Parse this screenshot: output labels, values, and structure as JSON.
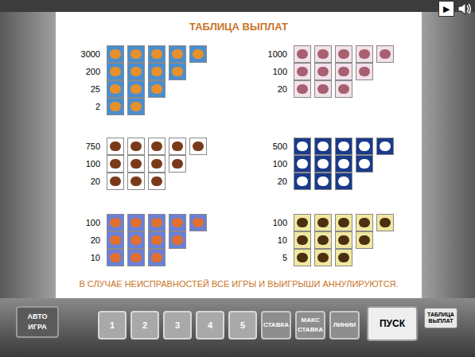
{
  "sound_controls": {
    "play": "▶"
  },
  "title": "ТАБЛИЦА ВЫПЛАТ",
  "groups": [
    {
      "color": "#4a8ed0",
      "accent": "#e8902a",
      "rows": [
        {
          "payout": "3000",
          "count": 5
        },
        {
          "payout": "200",
          "count": 4
        },
        {
          "payout": "25",
          "count": 3
        },
        {
          "payout": "2",
          "count": 2
        }
      ]
    },
    {
      "color": "#f2e2ea",
      "accent": "#a86070",
      "rows": [
        {
          "payout": "1000",
          "count": 5
        },
        {
          "payout": "100",
          "count": 4
        },
        {
          "payout": "20",
          "count": 3
        }
      ]
    },
    {
      "color": "#ffffff",
      "accent": "#7a3a1a",
      "rows": [
        {
          "payout": "750",
          "count": 5
        },
        {
          "payout": "100",
          "count": 4
        },
        {
          "payout": "20",
          "count": 3
        }
      ]
    },
    {
      "color": "#1a3a8a",
      "accent": "#ffffff",
      "rows": [
        {
          "payout": "500",
          "count": 5
        },
        {
          "payout": "100",
          "count": 4
        },
        {
          "payout": "20",
          "count": 3
        }
      ]
    },
    {
      "color": "#6a80d8",
      "accent": "#e07030",
      "rows": [
        {
          "payout": "100",
          "count": 5
        },
        {
          "payout": "20",
          "count": 4
        },
        {
          "payout": "10",
          "count": 3
        }
      ]
    },
    {
      "color": "#f0e8a0",
      "accent": "#4a3010",
      "rows": [
        {
          "payout": "100",
          "count": 5
        },
        {
          "payout": "10",
          "count": 4
        },
        {
          "payout": "5",
          "count": 3
        }
      ]
    }
  ],
  "notice": "В СЛУЧАЕ НЕИСПРАВНОСТЕЙ ВСЕ ИГРЫ И ВЫИГРЫШИ АННУЛИРУЮТСЯ.",
  "buttons": [
    {
      "label": "АВТО ИГРА",
      "kind": "auto"
    },
    {
      "label": "1",
      "kind": "number"
    },
    {
      "label": "2",
      "kind": "number"
    },
    {
      "label": "3",
      "kind": "number"
    },
    {
      "label": "4",
      "kind": "number"
    },
    {
      "label": "5",
      "kind": "number"
    },
    {
      "label": "СТАВКА",
      "kind": "control"
    },
    {
      "label": "МАКС СТАВКА",
      "kind": "control"
    },
    {
      "label": "ЛИНИИ",
      "kind": "control"
    },
    {
      "label": "ПУСК",
      "kind": "spin"
    },
    {
      "label": "ТАБЛИЦА ВЫПЛАТ",
      "kind": "paytable"
    }
  ]
}
